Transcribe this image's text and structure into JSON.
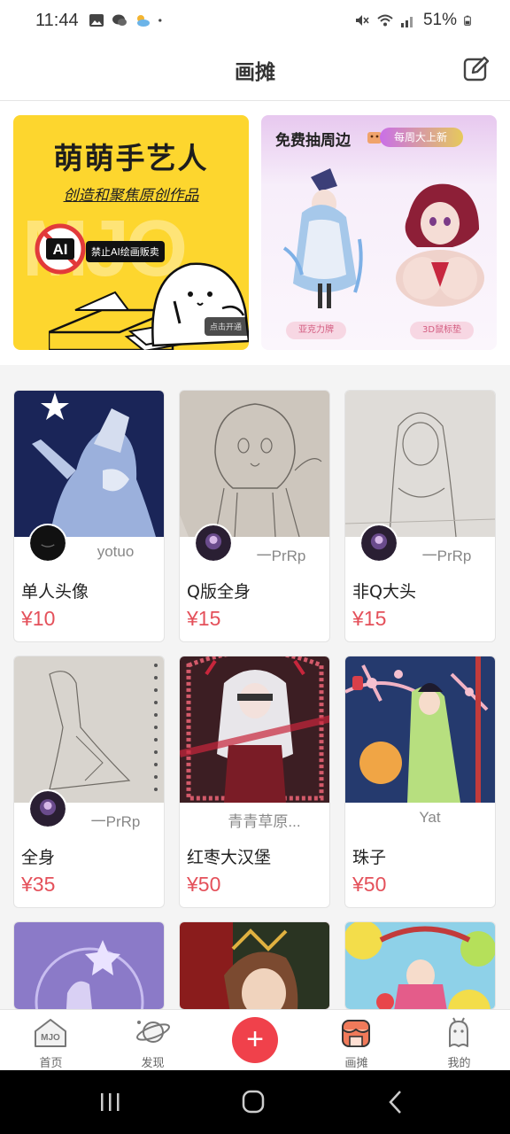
{
  "status": {
    "time": "11:44",
    "battery": "51%"
  },
  "header": {
    "title": "画摊"
  },
  "banner_left": {
    "title": "萌萌手艺人",
    "subtitle": "创造和聚焦原创作品",
    "watermark": "MJO",
    "ban_text": "禁止AI绘画贩卖",
    "ai_text": "AI",
    "tag": "点击开通"
  },
  "banner_right": {
    "title": "免费抽周边",
    "badge": "每周大上新",
    "item1": "亚克力牌",
    "item2": "3D鼠标垫"
  },
  "cards": [
    {
      "title": "单人头像",
      "price": "¥10",
      "author": "yotuo"
    },
    {
      "title": "Q版全身",
      "price": "¥15",
      "author": "一PrRp"
    },
    {
      "title": "非Q大头",
      "price": "¥15",
      "author": "一PrRp"
    },
    {
      "title": "全身",
      "price": "¥35",
      "author": "一PrRp"
    },
    {
      "title": "红枣大汉堡",
      "price": "¥50",
      "author": "青青草原..."
    },
    {
      "title": "珠子",
      "price": "¥50",
      "author": "Yat"
    }
  ],
  "tabs": {
    "home": "首页",
    "discover": "发现",
    "stall": "画摊",
    "mine": "我的",
    "home_logo": "MJO"
  },
  "colors": {
    "accent": "#f0414b",
    "price": "#e4505a",
    "banner_yellow": "#fdd62e"
  }
}
